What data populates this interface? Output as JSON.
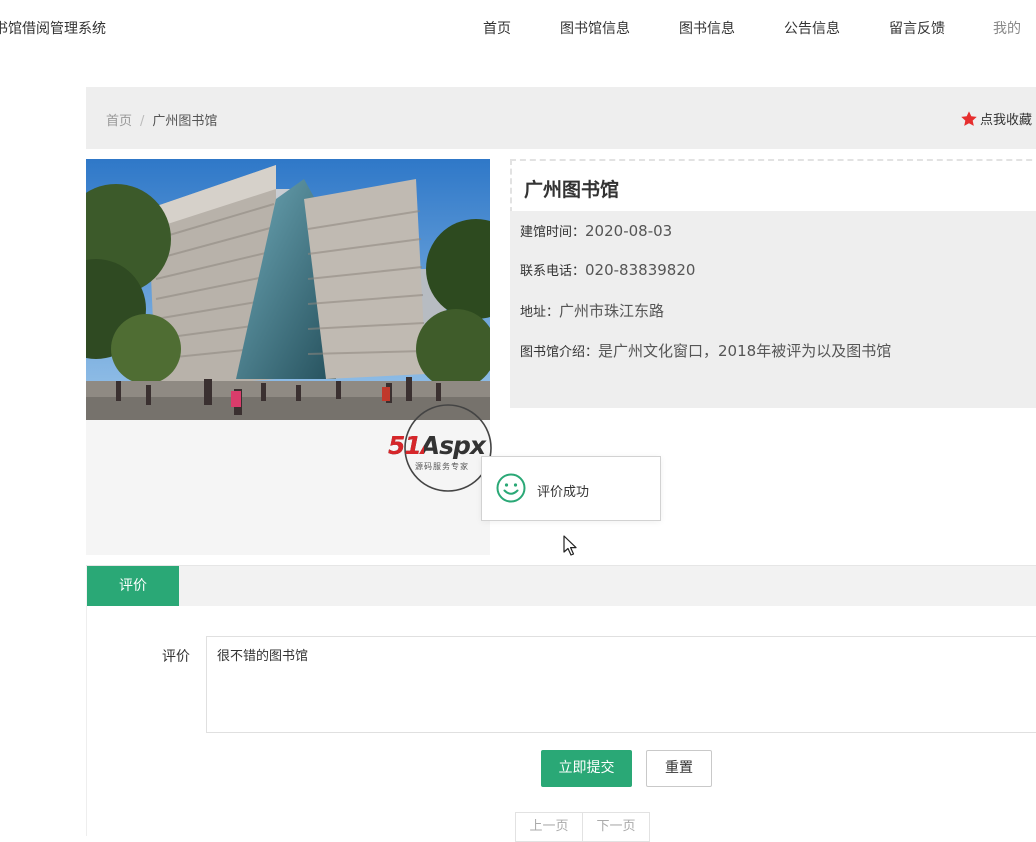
{
  "header": {
    "site_title": "书馆借阅管理系统",
    "nav": [
      "首页",
      "图书馆信息",
      "图书信息",
      "公告信息",
      "留言反馈",
      "我的"
    ]
  },
  "breadcrumb": {
    "home": "首页",
    "separator": "/",
    "current": "广州图书馆"
  },
  "favorite_label": "点我收藏",
  "library": {
    "name": "广州图书馆",
    "fields": [
      {
        "label": "建馆时间：",
        "value": "2020-08-03"
      },
      {
        "label": "联系电话：",
        "value": "020-83839820"
      },
      {
        "label": "地址：",
        "value": "广州市珠江东路"
      },
      {
        "label": "图书馆介绍：",
        "value": "是广州文化窗口，2018年被评为以及图书馆"
      }
    ]
  },
  "watermark": {
    "brand": "51Aspx",
    "tagline": "源码服务专家"
  },
  "toast": {
    "message": "评价成功"
  },
  "tabs": {
    "active": "评价"
  },
  "form": {
    "label": "评价",
    "value": "很不错的图书馆",
    "submit": "立即提交",
    "reset": "重置"
  },
  "pager": {
    "prev": "上一页",
    "next": "下一页"
  },
  "colors": {
    "accent": "#2aa876",
    "star": "#e62e2e"
  }
}
